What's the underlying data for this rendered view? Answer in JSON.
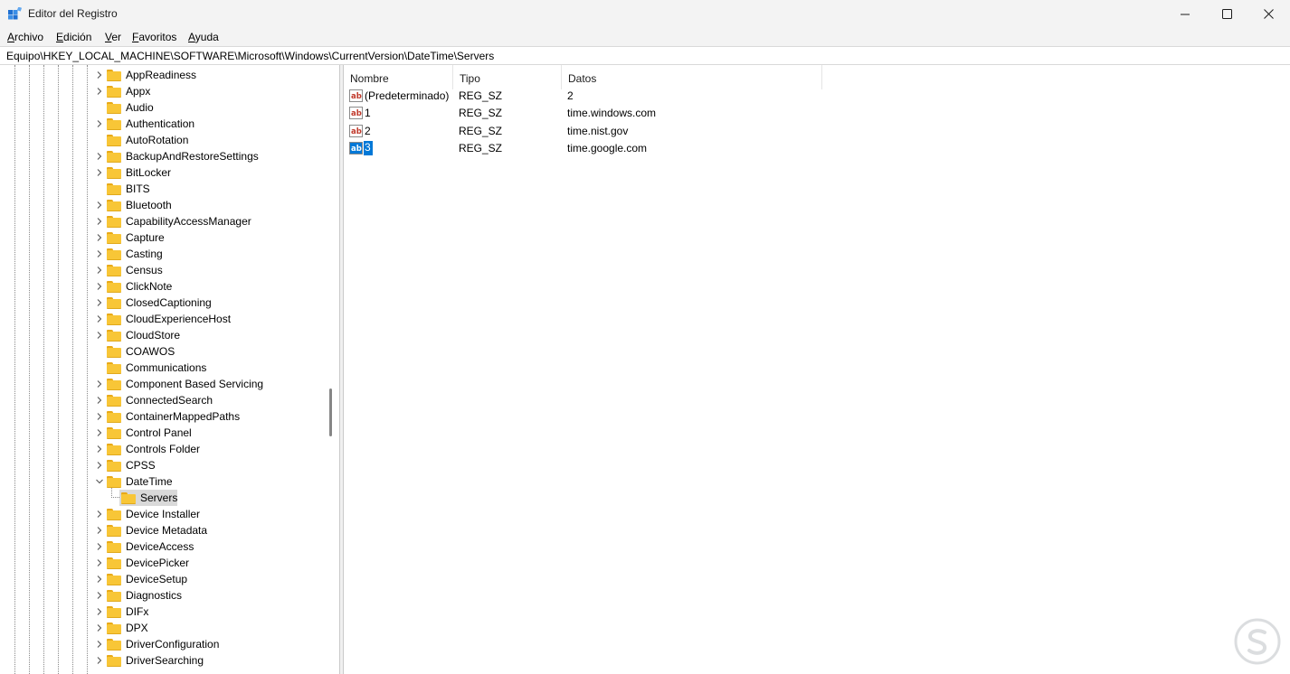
{
  "window": {
    "title": "Editor del Registro"
  },
  "menu": [
    {
      "label": "Archivo",
      "key": "A",
      "rest": "rchivo"
    },
    {
      "label": "Edición",
      "key": "E",
      "rest": "dición"
    },
    {
      "label": "Ver",
      "key": "V",
      "rest": "er"
    },
    {
      "label": "Favoritos",
      "key": "F",
      "rest": "avoritos"
    },
    {
      "label": "Ayuda",
      "key": "A",
      "rest": "yuda"
    }
  ],
  "address": "Equipo\\HKEY_LOCAL_MACHINE\\SOFTWARE\\Microsoft\\Windows\\CurrentVersion\\DateTime\\Servers",
  "tree": {
    "items": [
      {
        "label": "AppReadiness",
        "expandable": true
      },
      {
        "label": "Appx",
        "expandable": true
      },
      {
        "label": "Audio",
        "expandable": false
      },
      {
        "label": "Authentication",
        "expandable": true
      },
      {
        "label": "AutoRotation",
        "expandable": false
      },
      {
        "label": "BackupAndRestoreSettings",
        "expandable": true
      },
      {
        "label": "BitLocker",
        "expandable": true
      },
      {
        "label": "BITS",
        "expandable": false
      },
      {
        "label": "Bluetooth",
        "expandable": true
      },
      {
        "label": "CapabilityAccessManager",
        "expandable": true
      },
      {
        "label": "Capture",
        "expandable": true
      },
      {
        "label": "Casting",
        "expandable": true
      },
      {
        "label": "Census",
        "expandable": true
      },
      {
        "label": "ClickNote",
        "expandable": true
      },
      {
        "label": "ClosedCaptioning",
        "expandable": true
      },
      {
        "label": "CloudExperienceHost",
        "expandable": true
      },
      {
        "label": "CloudStore",
        "expandable": true
      },
      {
        "label": "COAWOS",
        "expandable": false
      },
      {
        "label": "Communications",
        "expandable": false
      },
      {
        "label": "Component Based Servicing",
        "expandable": true
      },
      {
        "label": "ConnectedSearch",
        "expandable": true
      },
      {
        "label": "ContainerMappedPaths",
        "expandable": true
      },
      {
        "label": "Control Panel",
        "expandable": true
      },
      {
        "label": "Controls Folder",
        "expandable": true
      },
      {
        "label": "CPSS",
        "expandable": true
      },
      {
        "label": "DateTime",
        "expandable": true,
        "expanded": true
      },
      {
        "label": "Servers",
        "child": true,
        "selected": true
      },
      {
        "label": "Device Installer",
        "expandable": true
      },
      {
        "label": "Device Metadata",
        "expandable": true
      },
      {
        "label": "DeviceAccess",
        "expandable": true
      },
      {
        "label": "DevicePicker",
        "expandable": true
      },
      {
        "label": "DeviceSetup",
        "expandable": true
      },
      {
        "label": "Diagnostics",
        "expandable": true
      },
      {
        "label": "DIFx",
        "expandable": true
      },
      {
        "label": "DPX",
        "expandable": true
      },
      {
        "label": "DriverConfiguration",
        "expandable": true
      },
      {
        "label": "DriverSearching",
        "expandable": true
      }
    ]
  },
  "values": {
    "columns": [
      "Nombre",
      "Tipo",
      "Datos"
    ],
    "rows": [
      {
        "name": "(Predeterminado)",
        "type": "REG_SZ",
        "data": "2",
        "selected": false
      },
      {
        "name": "1",
        "type": "REG_SZ",
        "data": "time.windows.com",
        "selected": false
      },
      {
        "name": "2",
        "type": "REG_SZ",
        "data": "time.nist.gov",
        "selected": false
      },
      {
        "name": "3",
        "type": "REG_SZ",
        "data": "time.google.com",
        "selected": true
      }
    ]
  },
  "colors": {
    "selection": "#0078d7",
    "folder": "#f8c637",
    "chrome": "#f3f3f3"
  },
  "icons": {
    "app": "registry-editor-icon",
    "minimize": "minimize-icon",
    "maximize": "maximize-icon",
    "close": "close-icon",
    "value": "string-value-icon",
    "folder": "folder-icon"
  }
}
